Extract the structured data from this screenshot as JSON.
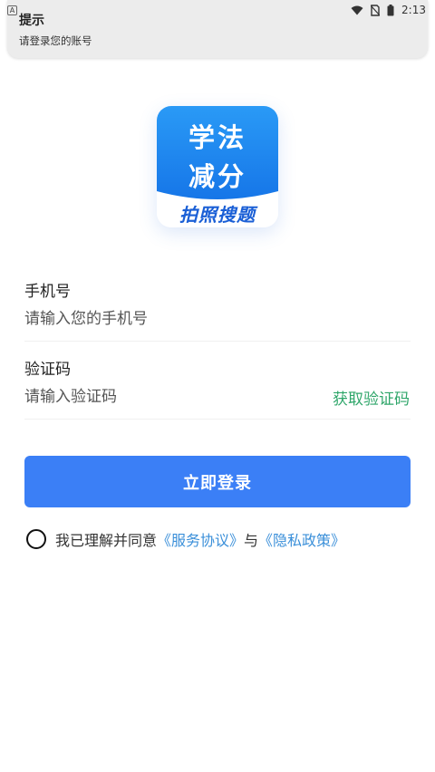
{
  "status_bar": {
    "left_icon": "A",
    "time": "2:13",
    "icons": [
      "wifi-icon",
      "no-sim-icon",
      "battery-icon"
    ]
  },
  "notification": {
    "title": "提示",
    "message": "请登录您的账号"
  },
  "logo": {
    "line1": "学法",
    "line2": "减分",
    "tagline": "拍照搜题",
    "colors": {
      "blue": "#1a86ee",
      "tagline": "#1a5fd6"
    }
  },
  "form": {
    "phone_label": "手机号",
    "phone_placeholder": "请输入您的手机号",
    "code_label": "验证码",
    "code_placeholder": "请输入验证码",
    "get_code": "获取验证码"
  },
  "login_button": "立即登录",
  "agreement": {
    "prefix": "我已理解并同意",
    "service": "《服务协议》",
    "and": "与",
    "privacy": "《隐私政策》"
  },
  "colors": {
    "primary": "#3b7ff6",
    "link": "#3a8fd9",
    "success": "#2fa66a"
  }
}
